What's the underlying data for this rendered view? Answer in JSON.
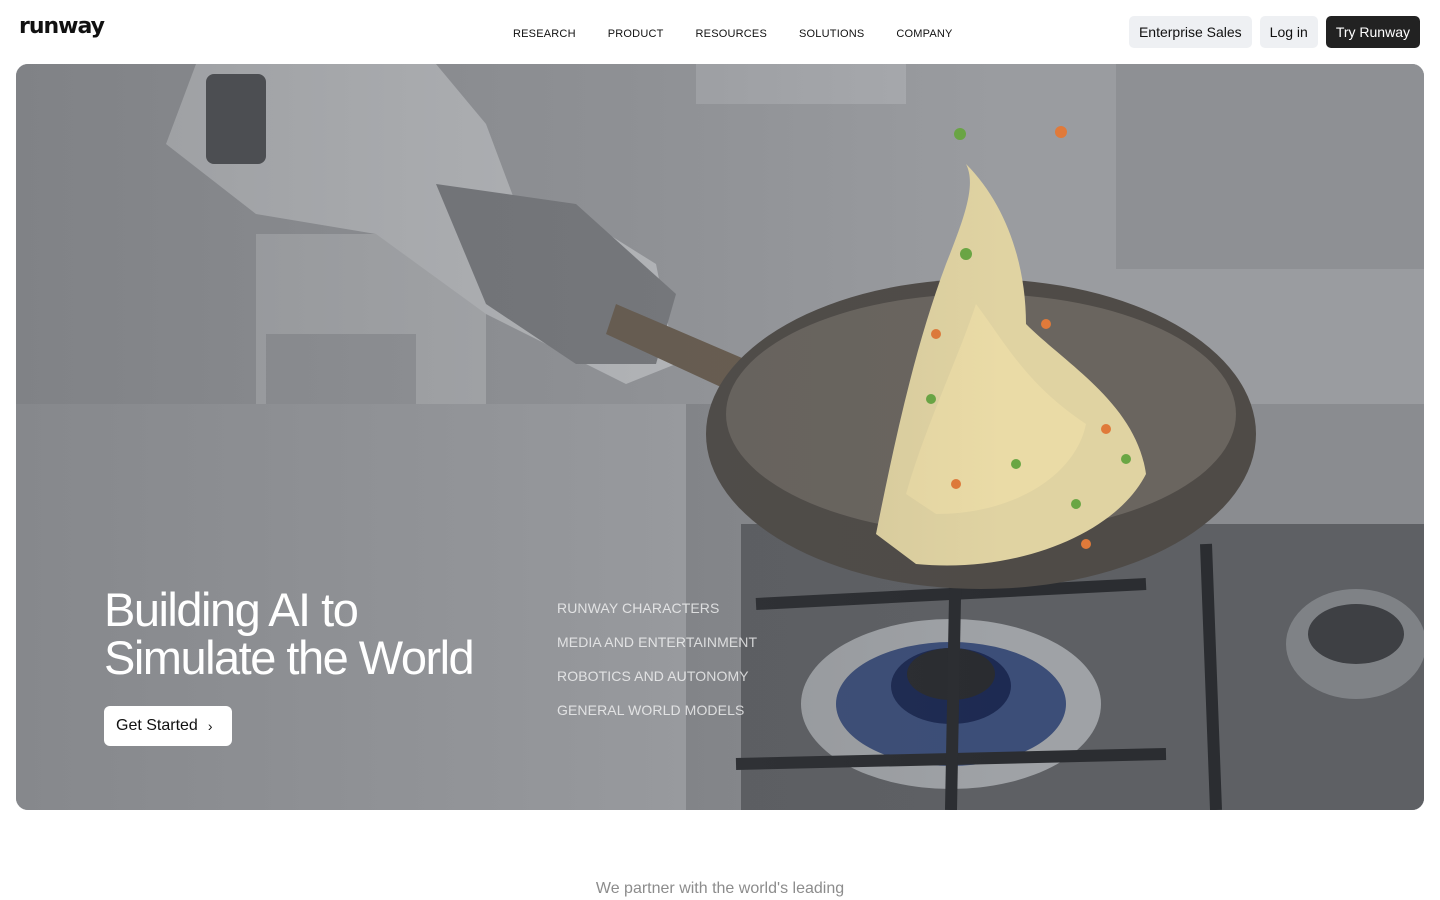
{
  "brand": {
    "logo_text": "runway"
  },
  "nav": {
    "items": [
      {
        "label": "RESEARCH"
      },
      {
        "label": "PRODUCT"
      },
      {
        "label": "RESOURCES"
      },
      {
        "label": "SOLUTIONS"
      },
      {
        "label": "COMPANY"
      }
    ]
  },
  "actions": {
    "enterprise": "Enterprise Sales",
    "login": "Log in",
    "try": "Try Runway"
  },
  "hero": {
    "headline_line1": "Building AI to",
    "headline_line2": "Simulate the World",
    "cta_label": "Get Started",
    "categories": [
      {
        "label": "RUNWAY CHARACTERS"
      },
      {
        "label": "MEDIA AND ENTERTAINMENT"
      },
      {
        "label": "ROBOTICS AND AUTONOMY"
      },
      {
        "label": "GENERAL WORLD MODELS"
      }
    ]
  },
  "partners": {
    "intro": "We partner with the world's leading"
  },
  "colors": {
    "dark_button": "#222222",
    "light_button": "#eef0f3",
    "hero_gray": "#8f9297"
  }
}
